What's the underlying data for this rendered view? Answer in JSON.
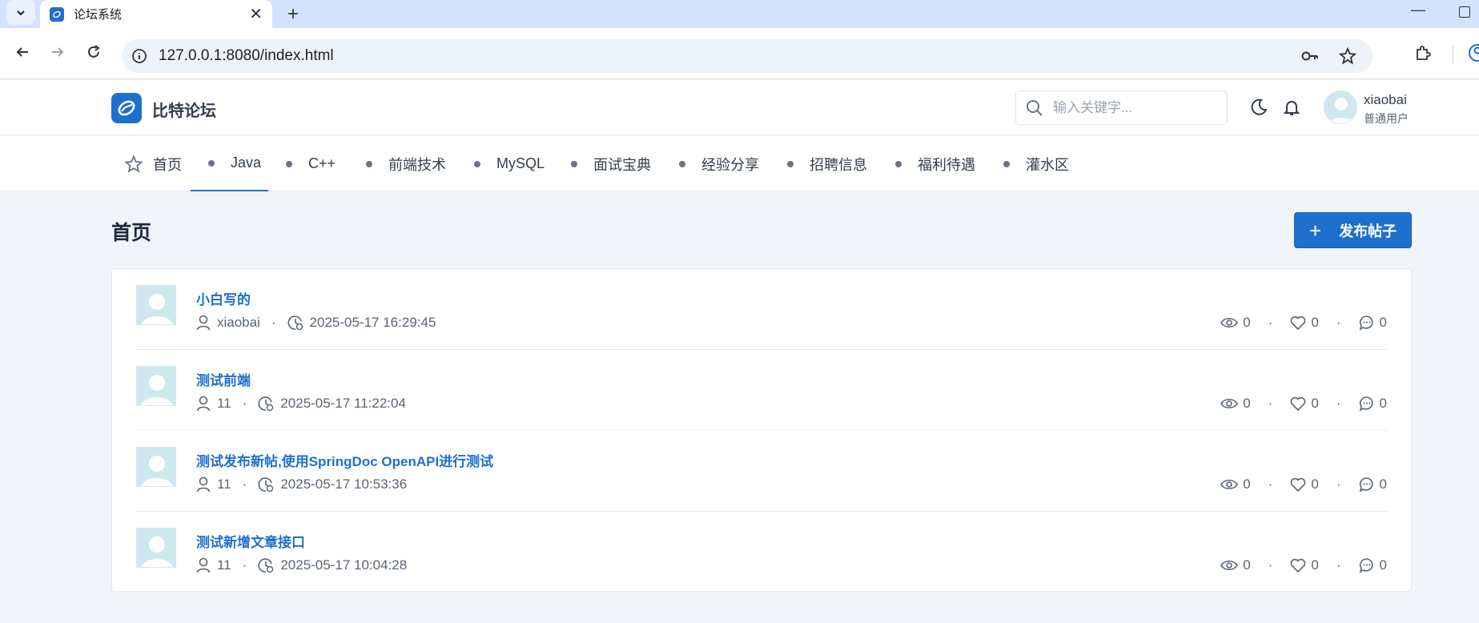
{
  "browser": {
    "tab_title": "论坛系统",
    "url": "127.0.0.1:8080/index.html"
  },
  "site": {
    "brand": "比特论坛",
    "search_placeholder": "输入关键字...",
    "user": {
      "name": "xiaobai",
      "role": "普通用户"
    }
  },
  "nav": {
    "home": "首页",
    "categories": [
      "Java",
      "C++",
      "前端技术",
      "MySQL",
      "面试宝典",
      "经验分享",
      "招聘信息",
      "福利待遇",
      "灌水区"
    ],
    "active": "Java"
  },
  "main": {
    "page_title": "首页",
    "publish_label": "发布帖子",
    "posts": [
      {
        "title": "小白写的",
        "author": "xiaobai",
        "time": "2025-05-17 16:29:45",
        "views": "0",
        "likes": "0",
        "comments": "0"
      },
      {
        "title": "测试前端",
        "author": "11",
        "time": "2025-05-17 11:22:04",
        "views": "0",
        "likes": "0",
        "comments": "0"
      },
      {
        "title": "测试发布新帖,使用SpringDoc OpenAPI进行测试",
        "author": "11",
        "time": "2025-05-17 10:53:36",
        "views": "0",
        "likes": "0",
        "comments": "0"
      },
      {
        "title": "测试新增文章接口",
        "author": "11",
        "time": "2025-05-17 10:04:28",
        "views": "0",
        "likes": "0",
        "comments": "0"
      }
    ]
  },
  "colors": {
    "accent": "#1f6fcf",
    "background": "#f1f4f8",
    "tabbar": "#d3e3fd"
  }
}
